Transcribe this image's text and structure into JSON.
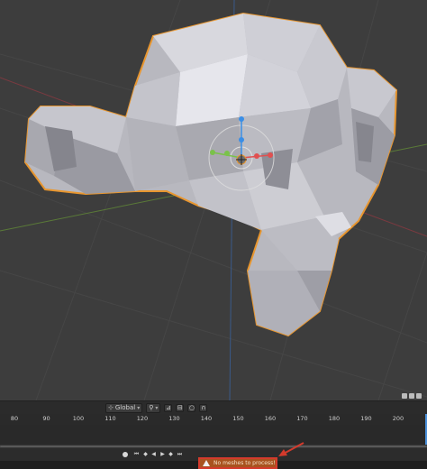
{
  "viewport": {
    "object": "monkey-head-mesh",
    "selection_color": "#e8962f"
  },
  "timeline_header": {
    "orientation_value": "Global",
    "icons": [
      "view-icon",
      "transform-orientation-icon",
      "pivot-icon",
      "snap-icon",
      "proportional-edit-icon",
      "falloff-icon"
    ]
  },
  "timeline": {
    "frame_labels": [
      "80",
      "90",
      "100",
      "110",
      "120",
      "130",
      "140",
      "150",
      "160",
      "170",
      "180",
      "190",
      "200"
    ],
    "current_frame": 210
  },
  "playback": {
    "buttons": [
      "record",
      "jump-start",
      "step-back",
      "play-reverse",
      "play",
      "step-forward",
      "jump-end"
    ]
  },
  "status": {
    "report_text": "No meshes to process!",
    "highlight_color": "#d33a2c"
  }
}
